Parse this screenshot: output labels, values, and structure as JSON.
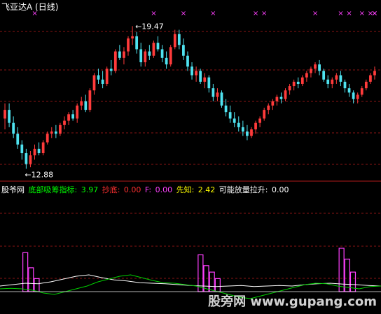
{
  "window": {
    "title": "飞亚达A (日线)",
    "bg": "#000000"
  },
  "colors": {
    "up": "#ff3b3b",
    "down": "#4fe3f0",
    "grid": "#8a1414",
    "marker": "#ff40ff",
    "pink_bar": "#ff40ff",
    "white_line": "#ffffff",
    "green_line": "#00d000"
  },
  "indicator": {
    "name": "股爷网",
    "label1": "底部吸筹指标: ",
    "value1": "3.97",
    "label2": "抄底: ",
    "value2": "0.00",
    "label3": "F: ",
    "value3": "0.00",
    "label4": "先知: ",
    "value4": "2.42",
    "label5": "可能放量拉升: ",
    "value5": "0.00",
    "colors": [
      "#00ff00",
      "#ff3030",
      "#ff40ff",
      "#ffff00",
      "#ffffff"
    ]
  },
  "watermark": "股旁网 www.gupang.com",
  "chart_data": [
    {
      "type": "candlestick",
      "title": "飞亚达A (日线)",
      "annotations": [
        {
          "text": "19.47",
          "kind": "high"
        },
        {
          "text": "12.88",
          "kind": "low"
        }
      ],
      "price_range": [
        12.88,
        19.47
      ],
      "candles": [
        [
          15.2,
          15.9,
          14.7,
          15.6
        ],
        [
          15.6,
          15.9,
          14.8,
          15.0
        ],
        [
          15.0,
          15.3,
          14.3,
          14.5
        ],
        [
          14.5,
          14.8,
          13.8,
          14.0
        ],
        [
          14.0,
          14.2,
          13.3,
          13.6
        ],
        [
          13.6,
          13.8,
          12.88,
          13.1
        ],
        [
          13.1,
          13.7,
          12.95,
          13.5
        ],
        [
          13.5,
          14.0,
          13.3,
          13.8
        ],
        [
          13.8,
          14.1,
          13.5,
          13.6
        ],
        [
          13.6,
          14.2,
          13.5,
          14.1
        ],
        [
          14.1,
          14.6,
          14.0,
          14.5
        ],
        [
          14.5,
          14.8,
          14.3,
          14.6
        ],
        [
          14.6,
          14.9,
          14.3,
          14.5
        ],
        [
          14.5,
          15.0,
          14.4,
          14.9
        ],
        [
          14.9,
          15.3,
          14.7,
          15.1
        ],
        [
          15.1,
          15.5,
          14.9,
          15.4
        ],
        [
          15.4,
          15.6,
          15.1,
          15.2
        ],
        [
          15.2,
          15.9,
          15.0,
          15.8
        ],
        [
          15.8,
          16.2,
          15.6,
          16.0
        ],
        [
          16.0,
          16.3,
          15.5,
          15.6
        ],
        [
          15.6,
          16.6,
          15.5,
          16.5
        ],
        [
          16.5,
          17.3,
          16.3,
          17.2
        ],
        [
          17.2,
          17.5,
          16.8,
          17.0
        ],
        [
          17.0,
          17.4,
          16.6,
          16.8
        ],
        [
          16.8,
          17.6,
          16.7,
          17.5
        ],
        [
          17.5,
          17.9,
          17.2,
          17.4
        ],
        [
          17.4,
          18.4,
          17.3,
          18.3
        ],
        [
          18.3,
          18.6,
          17.9,
          18.0
        ],
        [
          18.0,
          18.5,
          17.7,
          18.3
        ],
        [
          18.3,
          19.0,
          18.1,
          18.9
        ],
        [
          18.9,
          19.47,
          18.6,
          19.0
        ],
        [
          19.0,
          19.2,
          18.2,
          18.4
        ],
        [
          18.4,
          18.7,
          17.6,
          17.8
        ],
        [
          17.8,
          18.4,
          17.6,
          18.3
        ],
        [
          18.3,
          18.6,
          17.9,
          18.1
        ],
        [
          18.1,
          18.8,
          18.0,
          18.7
        ],
        [
          18.7,
          19.0,
          18.3,
          18.4
        ],
        [
          18.4,
          18.6,
          17.8,
          18.0
        ],
        [
          18.0,
          18.3,
          17.5,
          17.7
        ],
        [
          17.7,
          18.6,
          17.6,
          18.5
        ],
        [
          18.5,
          19.3,
          18.4,
          19.1
        ],
        [
          19.1,
          19.3,
          18.4,
          18.6
        ],
        [
          18.6,
          18.9,
          17.9,
          18.1
        ],
        [
          18.1,
          18.3,
          17.4,
          17.6
        ],
        [
          17.6,
          17.8,
          17.0,
          17.2
        ],
        [
          17.2,
          17.6,
          16.9,
          17.4
        ],
        [
          17.4,
          17.5,
          16.8,
          16.9
        ],
        [
          16.9,
          17.3,
          16.6,
          17.1
        ],
        [
          17.1,
          17.2,
          16.4,
          16.6
        ],
        [
          16.6,
          16.8,
          16.0,
          16.2
        ],
        [
          16.2,
          16.6,
          16.0,
          16.4
        ],
        [
          16.4,
          16.5,
          15.7,
          15.8
        ],
        [
          15.8,
          16.1,
          15.3,
          15.5
        ],
        [
          15.5,
          15.8,
          15.0,
          15.2
        ],
        [
          15.2,
          15.5,
          14.8,
          15.0
        ],
        [
          15.0,
          15.3,
          14.6,
          14.8
        ],
        [
          14.8,
          15.1,
          14.4,
          14.6
        ],
        [
          14.6,
          14.9,
          14.2,
          14.4
        ],
        [
          14.4,
          14.8,
          14.3,
          14.7
        ],
        [
          14.7,
          15.1,
          14.5,
          15.0
        ],
        [
          15.0,
          15.3,
          14.8,
          15.2
        ],
        [
          15.2,
          15.7,
          15.1,
          15.6
        ],
        [
          15.6,
          15.9,
          15.4,
          15.8
        ],
        [
          15.8,
          16.1,
          15.6,
          16.0
        ],
        [
          16.0,
          16.3,
          15.8,
          16.2
        ],
        [
          16.2,
          16.4,
          15.9,
          16.1
        ],
        [
          16.1,
          16.6,
          16.0,
          16.5
        ],
        [
          16.5,
          16.8,
          16.3,
          16.7
        ],
        [
          16.7,
          17.0,
          16.5,
          16.9
        ],
        [
          16.9,
          17.1,
          16.6,
          16.8
        ],
        [
          16.8,
          17.2,
          16.7,
          17.1
        ],
        [
          17.1,
          17.4,
          16.9,
          17.3
        ],
        [
          17.3,
          17.6,
          17.1,
          17.5
        ],
        [
          17.5,
          17.8,
          17.3,
          17.7
        ],
        [
          17.7,
          17.9,
          17.2,
          17.4
        ],
        [
          17.4,
          17.5,
          16.9,
          17.0
        ],
        [
          17.0,
          17.2,
          16.6,
          16.8
        ],
        [
          16.8,
          17.1,
          16.6,
          17.0
        ],
        [
          17.0,
          17.3,
          16.8,
          17.2
        ],
        [
          17.2,
          17.4,
          16.7,
          16.9
        ],
        [
          16.9,
          17.0,
          16.4,
          16.6
        ],
        [
          16.6,
          16.8,
          16.2,
          16.4
        ],
        [
          16.4,
          16.5,
          15.9,
          16.1
        ],
        [
          16.1,
          16.4,
          15.9,
          16.3
        ],
        [
          16.3,
          16.7,
          16.2,
          16.6
        ],
        [
          16.6,
          17.0,
          16.5,
          16.9
        ],
        [
          16.9,
          17.3,
          16.8,
          17.2
        ],
        [
          17.2,
          17.6,
          17.0,
          17.4
        ]
      ],
      "markers": [
        7,
        35,
        42,
        49,
        59,
        61,
        73,
        79,
        81,
        84,
        86,
        88,
        95,
        110
      ]
    },
    {
      "type": "indicator",
      "name": "底部吸筹指标",
      "bars": [
        {
          "pos": 0.06,
          "h": 0.9
        },
        {
          "pos": 0.075,
          "h": 0.55
        },
        {
          "pos": 0.09,
          "h": 0.3
        },
        {
          "pos": 0.52,
          "h": 0.85
        },
        {
          "pos": 0.535,
          "h": 0.6
        },
        {
          "pos": 0.55,
          "h": 0.45
        },
        {
          "pos": 0.565,
          "h": 0.3
        },
        {
          "pos": 0.89,
          "h": 1.0
        },
        {
          "pos": 0.905,
          "h": 0.75
        },
        {
          "pos": 0.92,
          "h": 0.45
        }
      ],
      "white_line": [
        0.2,
        0.25,
        0.3,
        0.28,
        0.35,
        0.45,
        0.55,
        0.6,
        0.5,
        0.42,
        0.38,
        0.32,
        0.3,
        0.28,
        0.25,
        0.22,
        0.2,
        0.18,
        0.2,
        0.22,
        0.18,
        0.2,
        0.22,
        0.2,
        0.25,
        0.28,
        0.3,
        0.27,
        0.25,
        0.22,
        0.2
      ],
      "green_line": [
        0.1,
        0.12,
        0.1,
        0.05,
        -0.05,
        -0.1,
        0.0,
        0.1,
        0.2,
        0.35,
        0.45,
        0.55,
        0.6,
        0.5,
        0.4,
        0.32,
        0.3,
        0.25,
        0.2,
        0.1,
        0.0,
        -0.1,
        -0.2,
        -0.25,
        -0.15,
        -0.05,
        0.05,
        0.15,
        0.25,
        0.3,
        0.28,
        0.2,
        0.15,
        0.1,
        0.18,
        0.2
      ]
    }
  ]
}
